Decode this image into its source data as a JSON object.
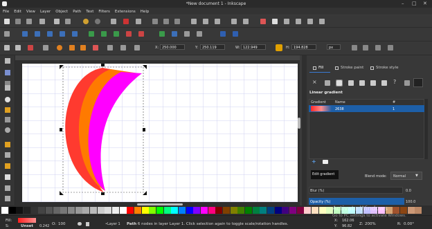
{
  "window": {
    "title": "*New document 1 - Inkscape"
  },
  "menu": [
    "File",
    "Edit",
    "View",
    "Layer",
    "Object",
    "Path",
    "Text",
    "Filters",
    "Extensions",
    "Help"
  ],
  "toolbar": {
    "x_label": "X:",
    "x_value": "250.000",
    "y_label": "Y:",
    "y_value": "250.119",
    "w_label": "W:",
    "w_value": "122.949",
    "h_label": "H:",
    "h_value": "194.828",
    "unit": "px"
  },
  "fill_panel": {
    "tabs": [
      "Fill",
      "Stroke paint",
      "Stroke style"
    ],
    "section_title": "Linear gradient",
    "columns": [
      "Gradient",
      "Name",
      "#"
    ],
    "rows": [
      {
        "name": "2638",
        "count": "1"
      }
    ],
    "tooltip": "Edit gradient",
    "blend_label": "Blend mode:",
    "blend_value": "Normal",
    "blur_label": "Blur (%)",
    "blur_value": "0.0",
    "opacity_label": "Opacity (%)",
    "opacity_value": "100.0"
  },
  "status": {
    "fill_label": "Fill:",
    "stroke_label": "S:",
    "stroke_value": "Unset",
    "stroke_width": "0.242",
    "opacity_label": "O:",
    "opacity_value": "100",
    "layer": "•Layer 1",
    "message_bold": "Path",
    "message": " 6 nodes in layer Layer 1. Click selection again to toggle scale/rotation handles.",
    "x_label": "X:",
    "x_value": "162.06",
    "y_label": "Y:",
    "y_value": "96.82",
    "zoom_label": "Z:",
    "zoom_value": "200%",
    "rotate_label": "R:",
    "rotate_value": "0.00°"
  },
  "watermark": {
    "line1": "Activate Windows",
    "line2": "Go to PC settings to activate Windows."
  },
  "colors": {
    "crescent_outer": "#ff3a2f",
    "crescent_mid": "#ff7a00",
    "crescent_inner": "#ff00ff",
    "panel_selection": "#1d5fa8"
  }
}
